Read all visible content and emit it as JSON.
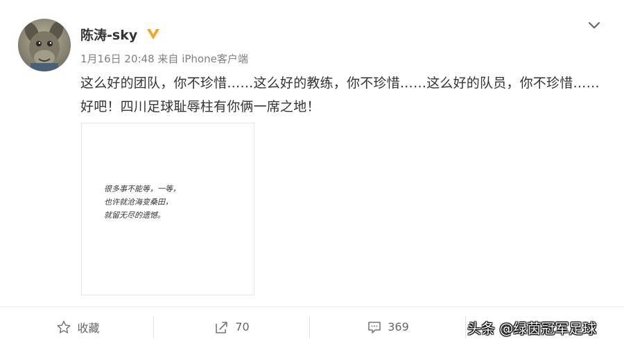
{
  "post": {
    "username": "陈涛-sky",
    "timestamp": "1月16日 20:48",
    "source": "来自 iPhone客户端",
    "text": "这么好的团队，你不珍惜……这么好的教练，你不珍惜……这么好的队员，你不珍惜……好吧！四川足球耻辱柱有你俩一席之地！",
    "image_text_lines": [
      "很多事不能等，一等，",
      "也许就沧海变桑田，",
      "就留无尽的遗憾。"
    ],
    "badge_color": "#f5a623"
  },
  "toolbar": {
    "favorite_label": "收藏",
    "repost_count": "70",
    "comment_count": "369"
  },
  "watermark": "头条 @绿茵冠军足球",
  "icons": {
    "more": "chevron-down-icon",
    "favorite": "star-icon",
    "repost": "repost-icon",
    "comment": "comment-icon",
    "vip": "vip-badge-icon"
  }
}
